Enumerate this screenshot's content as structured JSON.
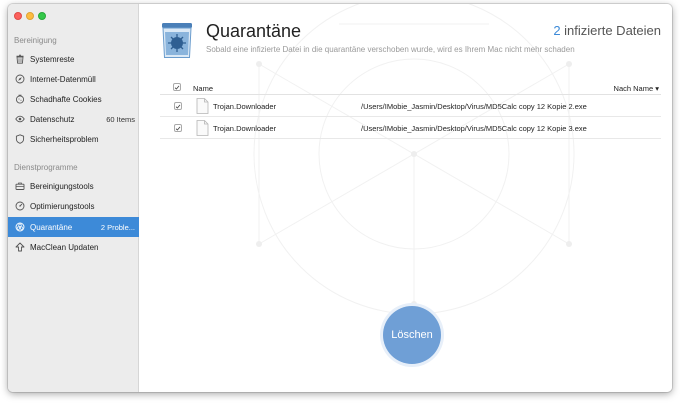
{
  "sidebar": {
    "section_cleanup": "Bereinigung",
    "section_utilities": "Dienstprogramme",
    "items": [
      {
        "label": "Systemreste",
        "badge": "",
        "icon": "trash-icon"
      },
      {
        "label": "Internet-Datenmüll",
        "badge": "",
        "icon": "compass-icon"
      },
      {
        "label": "Schadhafte Cookies",
        "badge": "",
        "icon": "cookie-icon"
      },
      {
        "label": "Datenschutz",
        "badge": "60 Items",
        "icon": "eye-icon"
      },
      {
        "label": "Sicherheitsproblem",
        "badge": "",
        "icon": "shield-icon"
      },
      {
        "label": "Bereinigungstools",
        "badge": "",
        "icon": "toolbox-icon"
      },
      {
        "label": "Optimierungstools",
        "badge": "",
        "icon": "gauge-icon"
      },
      {
        "label": "Quarantäne",
        "badge": "2 Proble...",
        "icon": "biohazard-icon"
      },
      {
        "label": "MacClean Updaten",
        "badge": "",
        "icon": "update-arrow-icon"
      }
    ]
  },
  "header": {
    "title": "Quarantäne",
    "subtitle": "Sobald eine infizierte Datei in die quarantäne verschoben wurde, wird es Ihrem Mac nicht mehr schaden",
    "count_number": "2",
    "count_label": " infizierte Dateien"
  },
  "table": {
    "col_name": "Name",
    "col_sort": "Nach Name ▾",
    "rows": [
      {
        "name": "Trojan.Downloader",
        "path": "/Users/IMobie_Jasmin/Desktop/Virus/MD5Calc copy 12 Kopie 2.exe",
        "checked": true
      },
      {
        "name": "Trojan.Downloader",
        "path": "/Users/IMobie_Jasmin/Desktop/Virus/MD5Calc copy 12 Kopie 3.exe",
        "checked": true
      }
    ]
  },
  "actions": {
    "delete_label": "Löschen"
  },
  "colors": {
    "accent": "#3d8ad8",
    "button": "#6f9fd6",
    "sidebar_bg": "#ececec"
  }
}
